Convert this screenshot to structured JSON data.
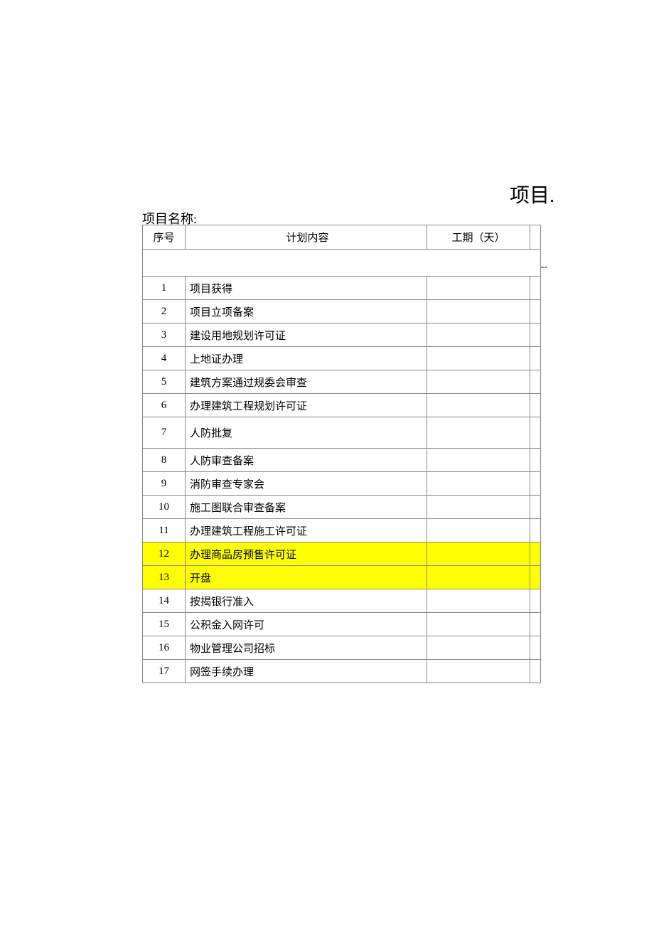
{
  "title": "项目.",
  "subtitle": "项目名称:",
  "dash": "--",
  "headers": {
    "num": "序号",
    "content": "计划内容",
    "duration": "工期（天）"
  },
  "rows": [
    {
      "n": "1",
      "c": "项目获得",
      "d": "",
      "hl": false,
      "tall": false
    },
    {
      "n": "2",
      "c": "项目立项备案",
      "d": "",
      "hl": false,
      "tall": false
    },
    {
      "n": "3",
      "c": "建设用地规划许可证",
      "d": "",
      "hl": false,
      "tall": false
    },
    {
      "n": "4",
      "c": "上地证办理",
      "d": "",
      "hl": false,
      "tall": false
    },
    {
      "n": "5",
      "c": "建筑方案通过规委会审查",
      "d": "",
      "hl": false,
      "tall": false
    },
    {
      "n": "6",
      "c": "办理建筑工程规划许可证",
      "d": "",
      "hl": false,
      "tall": false
    },
    {
      "n": "7",
      "c": "人防批复",
      "d": "",
      "hl": false,
      "tall": true
    },
    {
      "n": "8",
      "c": "人防审查备案",
      "d": "",
      "hl": false,
      "tall": false
    },
    {
      "n": "9",
      "c": "消防审查专家会",
      "d": "",
      "hl": false,
      "tall": false
    },
    {
      "n": "10",
      "c": "施工图联合审查备案",
      "d": "",
      "hl": false,
      "tall": false
    },
    {
      "n": "11",
      "c": "办理建筑工程施工许可证",
      "d": "",
      "hl": false,
      "tall": false
    },
    {
      "n": "12",
      "c": "办理商品房预售许可证",
      "d": "",
      "hl": true,
      "tall": false
    },
    {
      "n": "13",
      "c": "开盘",
      "d": "",
      "hl": true,
      "tall": false
    },
    {
      "n": "14",
      "c": "按揭银行准入",
      "d": "",
      "hl": false,
      "tall": false
    },
    {
      "n": "15",
      "c": "公积金入网许可",
      "d": "",
      "hl": false,
      "tall": false
    },
    {
      "n": "16",
      "c": "物业管理公司招标",
      "d": "",
      "hl": false,
      "tall": false
    },
    {
      "n": "17",
      "c": "网签手续办理",
      "d": "",
      "hl": false,
      "tall": false
    }
  ]
}
